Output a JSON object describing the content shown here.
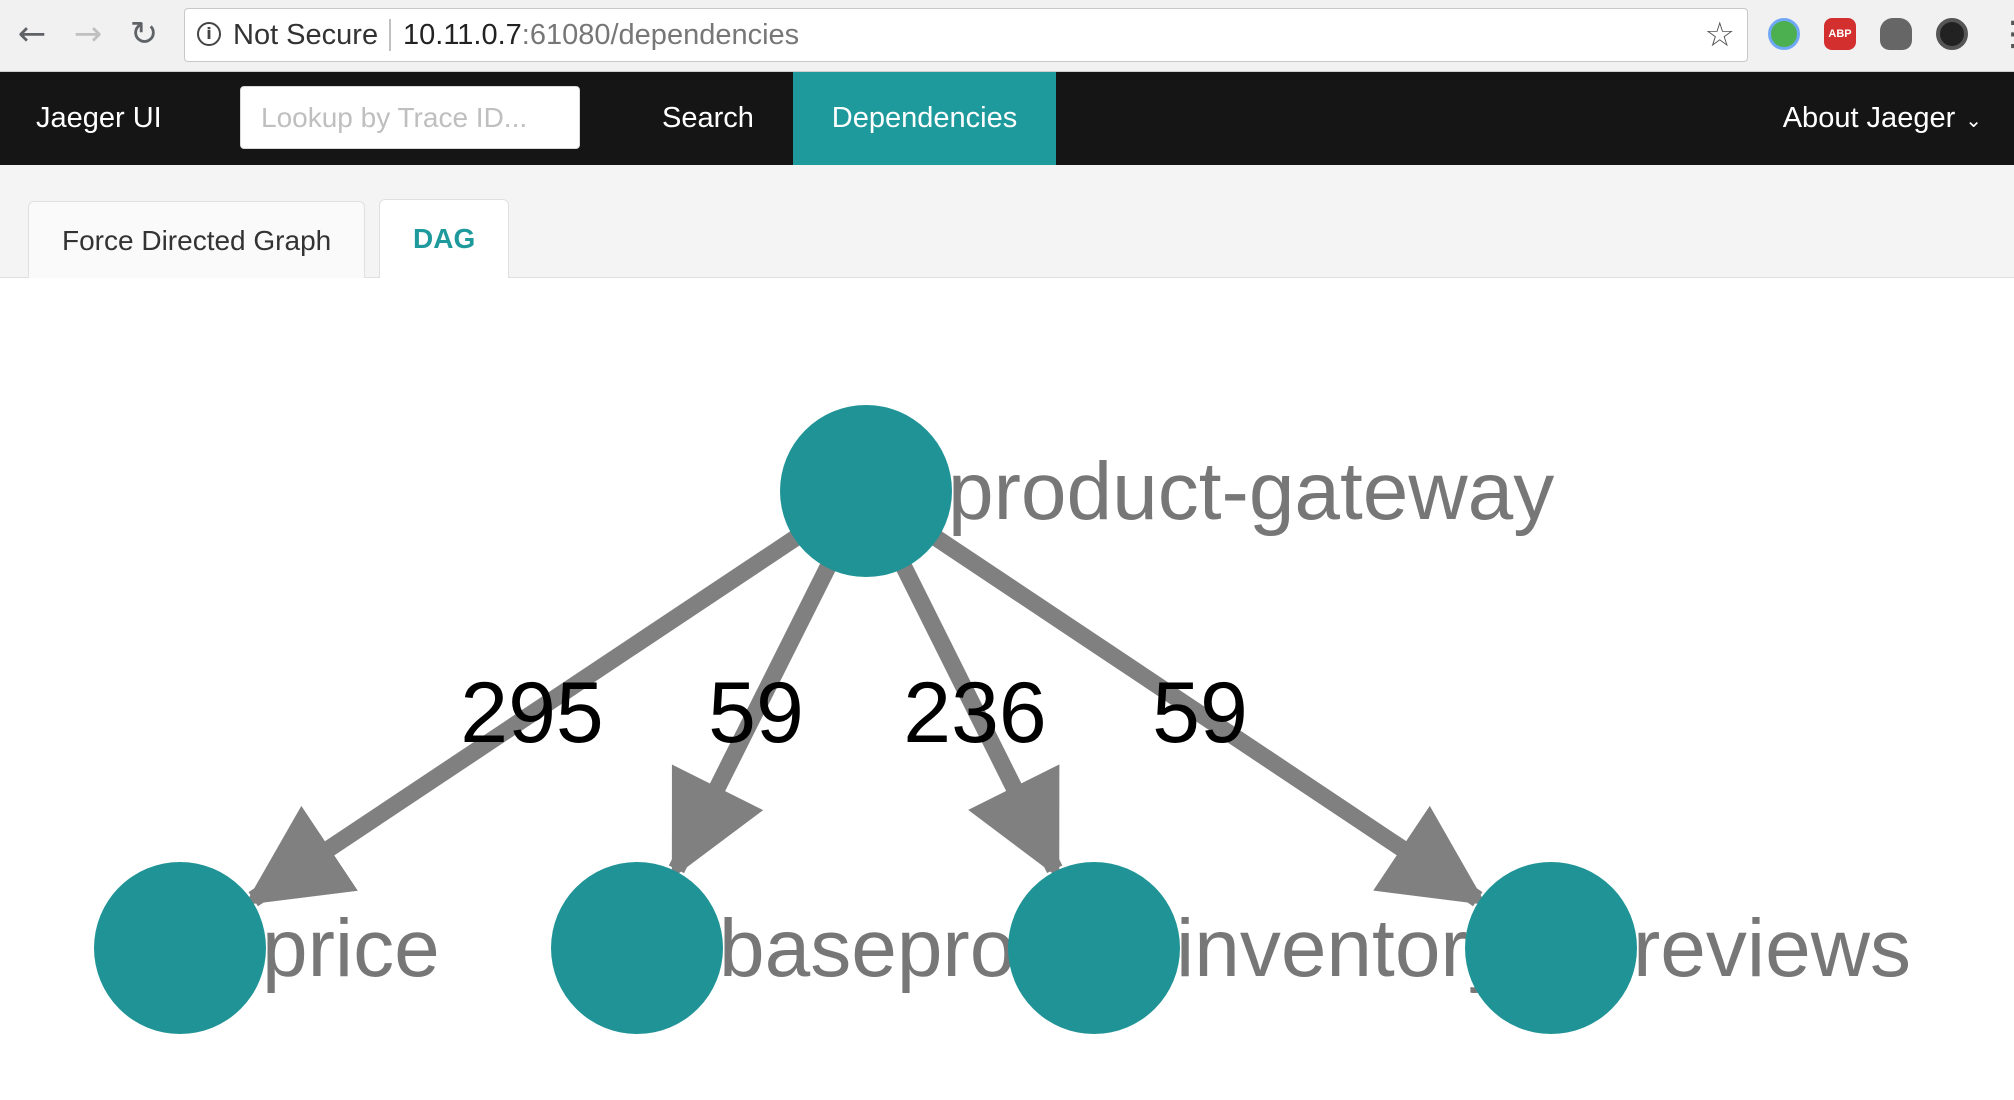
{
  "browser": {
    "security_label": "Not Secure",
    "url_host": "10.11.0.7",
    "url_rest": ":61080/dependencies",
    "extensions": [
      "chrome-ext-icon",
      "adblock-icon",
      "evernote-icon",
      "camera-ext-icon"
    ],
    "adblock_text": "ABP"
  },
  "nav": {
    "brand": "Jaeger UI",
    "lookup_placeholder": "Lookup by Trace ID...",
    "search": "Search",
    "dependencies": "Dependencies",
    "about": "About Jaeger"
  },
  "tabs": {
    "force": "Force Directed Graph",
    "dag": "DAG",
    "active": "DAG"
  },
  "graph": {
    "node_color": "#1f9396",
    "edge_color": "#808080",
    "root": "product-gateway",
    "children": [
      "price",
      "baseproduct",
      "inventory",
      "reviews"
    ],
    "edges": [
      {
        "from": "product-gateway",
        "to": "price",
        "calls": "295"
      },
      {
        "from": "product-gateway",
        "to": "baseproduct",
        "calls": "59"
      },
      {
        "from": "product-gateway",
        "to": "inventory",
        "calls": "236"
      },
      {
        "from": "product-gateway",
        "to": "reviews",
        "calls": "59"
      }
    ]
  }
}
